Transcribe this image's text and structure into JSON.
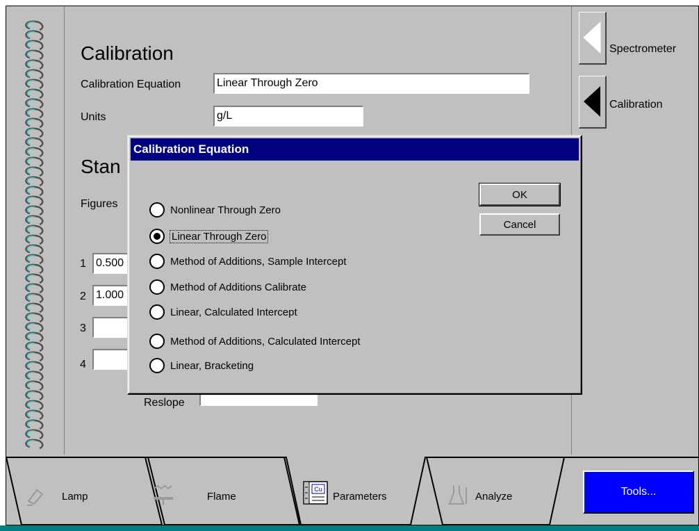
{
  "page": {
    "title": "Calibration",
    "calibration_equation_label": "Calibration Equation",
    "calibration_equation_value": "Linear Through Zero",
    "units_label": "Units",
    "units_value": "g/L",
    "standards_title": "Stan",
    "figures_label": "Figures",
    "reslope_label": "Reslope"
  },
  "standards": [
    {
      "num": "1",
      "value": "0.500"
    },
    {
      "num": "2",
      "value": "1.000"
    },
    {
      "num": "3",
      "value": ""
    },
    {
      "num": "4",
      "value": ""
    }
  ],
  "side_tabs": [
    {
      "label": "Spectrometer",
      "icon": "arrow-left-white-icon"
    },
    {
      "label": "Calibration",
      "icon": "arrow-left-black-icon"
    }
  ],
  "bottom_tabs": [
    {
      "label": "Lamp",
      "icon": "lamp-icon"
    },
    {
      "label": "Flame",
      "icon": "flame-icon"
    },
    {
      "label": "Parameters",
      "icon": "parameters-icon",
      "icon_text": "Cu"
    },
    {
      "label": "Analyze",
      "icon": "analyze-icon"
    }
  ],
  "tools_label": "Tools...",
  "dialog": {
    "title": "Calibration Equation",
    "ok_label": "OK",
    "cancel_label": "Cancel",
    "options": [
      {
        "label": "Nonlinear Through Zero",
        "checked": false
      },
      {
        "label": "Linear Through Zero",
        "checked": true
      },
      {
        "label": "Method of Additions, Sample Intercept",
        "checked": false
      },
      {
        "label": "Method of Additions Calibrate",
        "checked": false
      },
      {
        "label": "Linear, Calculated Intercept",
        "checked": false
      },
      {
        "label": "Method of Additions, Calculated Intercept",
        "checked": false
      },
      {
        "label": "Linear, Bracketing",
        "checked": false
      }
    ]
  },
  "colors": {
    "window_bg": "#c0c0c0",
    "title_bar": "#000080",
    "tools_button": "#0000ff",
    "spiral": "#40c0c0"
  }
}
